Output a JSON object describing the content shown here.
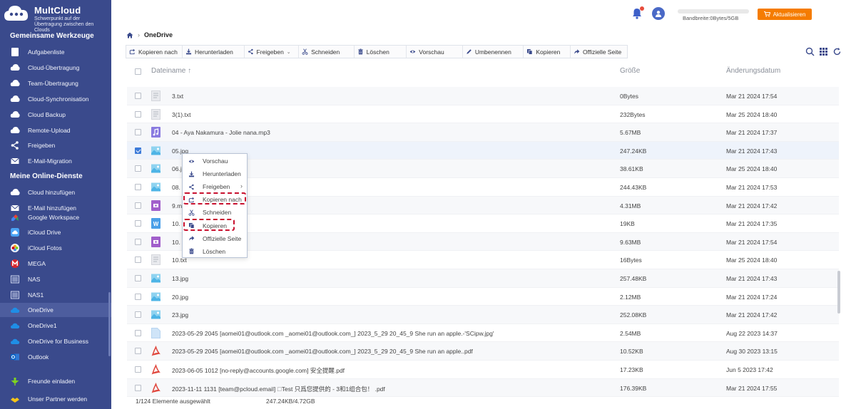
{
  "app": {
    "brand": "MultCloud",
    "tagline": "Schwerpunkt auf der Übertragung zwischen den Clouds"
  },
  "sidebar": {
    "section_tools": "Gemeinsame Werkzeuge",
    "tools": [
      {
        "label": "Aufgabenliste",
        "icon": "list-icon"
      },
      {
        "label": "Cloud-Übertragung",
        "icon": "cloud-transfer-icon"
      },
      {
        "label": "Team-Übertragung",
        "icon": "team-transfer-icon"
      },
      {
        "label": "Cloud-Synchronisation",
        "icon": "cloud-sync-icon"
      },
      {
        "label": "Cloud Backup",
        "icon": "cloud-backup-icon"
      },
      {
        "label": "Remote-Upload",
        "icon": "remote-upload-icon"
      },
      {
        "label": "Freigeben",
        "icon": "share-icon"
      },
      {
        "label": "E-Mail-Migration",
        "icon": "email-migration-icon"
      }
    ],
    "section_services": "Meine Online-Dienste",
    "services": [
      {
        "label": "Cloud hinzufügen",
        "icon": "add-cloud-icon"
      },
      {
        "label": "E-Mail hinzufügen",
        "icon": "add-email-icon"
      },
      {
        "label": "Google Workspace",
        "icon": "google-workspace-icon"
      },
      {
        "label": "iCloud Drive",
        "icon": "icloud-drive-icon"
      },
      {
        "label": "iCloud Fotos",
        "icon": "icloud-photos-icon"
      },
      {
        "label": "MEGA",
        "icon": "mega-icon"
      },
      {
        "label": "NAS",
        "icon": "nas-icon"
      },
      {
        "label": "NAS1",
        "icon": "nas-icon"
      },
      {
        "label": "OneDrive",
        "icon": "onedrive-icon",
        "active": true
      },
      {
        "label": "OneDrive1",
        "icon": "onedrive-icon"
      },
      {
        "label": "OneDrive for Business",
        "icon": "onedrive-business-icon"
      },
      {
        "label": "Outlook",
        "icon": "outlook-icon"
      }
    ],
    "bottom": [
      {
        "label": "Freunde einladen",
        "icon": "invite-friends-icon"
      },
      {
        "label": "Unser Partner werden",
        "icon": "partner-icon"
      }
    ]
  },
  "header": {
    "bandwidth": "Bandbreite:0Bytes/5GB",
    "bandwidth_used_fraction": 0,
    "upgrade_label": "Aktualisieren"
  },
  "breadcrumb": {
    "current": "OneDrive"
  },
  "toolbar": [
    {
      "label": "Kopieren nach",
      "icon": "copy-to-icon"
    },
    {
      "label": "Herunterladen",
      "icon": "download-icon"
    },
    {
      "label": "Freigeben",
      "icon": "share-icon",
      "dropdown": true
    },
    {
      "label": "Schneiden",
      "icon": "cut-icon"
    },
    {
      "label": "Löschen",
      "icon": "trash-icon"
    },
    {
      "label": "Vorschau",
      "icon": "eye-icon"
    },
    {
      "label": "Umbenennen",
      "icon": "rename-icon"
    },
    {
      "label": "Kopieren",
      "icon": "copy-icon"
    },
    {
      "label": "Offizielle Seite",
      "icon": "external-link-icon"
    }
  ],
  "table": {
    "columns": {
      "name": "Dateiname",
      "size": "Größe",
      "date": "Änderungsdatum"
    },
    "rows": [
      {
        "name": "3.txt",
        "size": "0Bytes",
        "date": "Mar 21 2024 17:54",
        "type": "txt"
      },
      {
        "name": "3(1).txt",
        "size": "232Bytes",
        "date": "Mar 25 2024 18:40",
        "type": "txt"
      },
      {
        "name": "04 - Aya Nakamura - Jolie nana.mp3",
        "size": "5.67MB",
        "date": "Mar 21 2024 17:37",
        "type": "audio"
      },
      {
        "name": "05.jpg",
        "size": "247.24KB",
        "date": "Mar 21 2024 17:43",
        "type": "image",
        "selected": true
      },
      {
        "name": "06.j",
        "size": "38.61KB",
        "date": "Mar 25 2024 18:40",
        "type": "image"
      },
      {
        "name": "08.",
        "size": "244.43KB",
        "date": "Mar 21 2024 17:53",
        "type": "image"
      },
      {
        "name": "9.m",
        "size": "4.31MB",
        "date": "Mar 21 2024 17:42",
        "type": "video"
      },
      {
        "name": "10.",
        "size": "19KB",
        "date": "Mar 21 2024 17:35",
        "type": "word"
      },
      {
        "name": "10.",
        "size": "9.63MB",
        "date": "Mar 21 2024 17:54",
        "type": "video"
      },
      {
        "name": "10.txt",
        "size": "16Bytes",
        "date": "Mar 25 2024 18:40",
        "type": "txt"
      },
      {
        "name": "13.jpg",
        "size": "257.48KB",
        "date": "Mar 21 2024 17:43",
        "type": "image"
      },
      {
        "name": "20.jpg",
        "size": "2.12MB",
        "date": "Mar 21 2024 17:24",
        "type": "image"
      },
      {
        "name": "23.jpg",
        "size": "252.08KB",
        "date": "Mar 21 2024 17:42",
        "type": "image"
      },
      {
        "name": "2023-05-29 2045 [aomei01@outlook.com _aomei01@outlook.com_] 2023_5_29 20_45_9 She run an apple.-'SCipw.jpg'",
        "size": "2.54MB",
        "date": "Aug 22 2023 14:37",
        "type": "file"
      },
      {
        "name": "2023-05-29 2045 [aomei01@outlook.com _aomei01@outlook.com_] 2023_5_29 20_45_9 She run an apple..pdf",
        "size": "10.52KB",
        "date": "Aug 30 2023 13:15",
        "type": "pdf"
      },
      {
        "name": "2023-06-05 1012 [no-reply@accounts.google.com] 安全提醒.pdf",
        "size": "17.23KB",
        "date": "Jun 5 2023 17:42",
        "type": "pdf"
      },
      {
        "name": "2023-11-11 1131 [team@pcloud.email] 🗆Test 只爲您提供的 - 3和1组合包！ .pdf",
        "size": "176.39KB",
        "date": "Mar 21 2024 17:55",
        "type": "pdf"
      }
    ]
  },
  "context_menu": [
    {
      "label": "Vorschau",
      "icon": "eye-icon"
    },
    {
      "label": "Herunterladen",
      "icon": "download-icon"
    },
    {
      "label": "Freigeben",
      "icon": "share-icon",
      "submenu": true
    },
    {
      "label": "Kopieren nach",
      "icon": "copy-to-icon",
      "highlighted": true
    },
    {
      "label": "Schneiden",
      "icon": "cut-icon"
    },
    {
      "label": "Kopieren",
      "icon": "copy-icon",
      "highlighted": true
    },
    {
      "label": "Offizielle Seite",
      "icon": "external-link-icon"
    },
    {
      "label": "Löschen",
      "icon": "trash-icon"
    }
  ],
  "footer": {
    "selection": "1/124 Elemente ausgewählt",
    "size": "247.24KB/4.72GB"
  },
  "colors": {
    "sidebar": "#3a4a8c",
    "accent": "#f57c00",
    "highlight": "#c8102e"
  }
}
